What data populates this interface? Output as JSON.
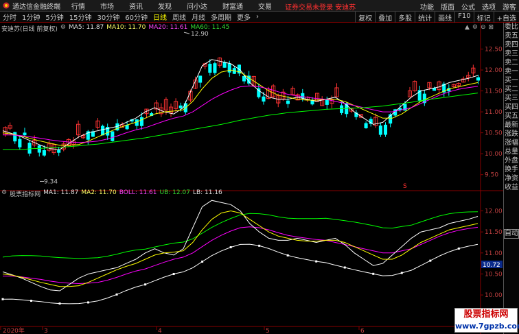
{
  "app": {
    "title": "通达信金融终端",
    "menu": [
      "行情",
      "市场",
      "资讯",
      "发现",
      "问小达",
      "财富通",
      "交易"
    ],
    "alert": "证券交易未登录 安迪苏",
    "right_menu": [
      "功能",
      "版面",
      "公式",
      "选项",
      "游客"
    ]
  },
  "toolbar": {
    "periods": [
      "分时",
      "1分钟",
      "5分钟",
      "15分钟",
      "30分钟",
      "60分钟",
      "日线",
      "周线",
      "月线",
      "多周期",
      "更多"
    ],
    "active_period": "日线",
    "tools": [
      "复权",
      "叠加",
      "多股",
      "统计",
      "画线",
      "F10",
      "标记",
      "+自选"
    ]
  },
  "main_chart": {
    "stock_name": "安迪苏(日线 前复权)",
    "ma5": "MA5: 11.87",
    "ma10": "MA10: 11.70",
    "ma20": "MA20: 11.61",
    "ma60": "MA60: 11.45",
    "high_label": "12.90",
    "low_label": "9.34",
    "s_marker": "S",
    "price_axis": [
      "12.50",
      "12.00",
      "11.50",
      "11.00",
      "10.50",
      "10.00",
      "9.50"
    ]
  },
  "sub_chart": {
    "name": "股票指标网",
    "ma1": "MA1: 11.87",
    "ma2": "MA2: 11.70",
    "boll": "BOLL: 11.61",
    "ub": "UB: 12.07",
    "lb": "LB: 11.16",
    "price_axis": [
      "12.00",
      "11.50",
      "11.00",
      "10.50",
      "10.00"
    ],
    "current_price": "10.72"
  },
  "x_axis": [
    "2020年",
    "3",
    "4",
    "5",
    "6"
  ],
  "sidebar": {
    "tabs": [
      "委比",
      "卖五",
      "卖四",
      "卖三",
      "卖二",
      "卖一",
      "买一",
      "买二",
      "买三",
      "买四",
      "买五",
      "最新",
      "涨跌",
      "涨幅",
      "总量",
      "外盘",
      "换手",
      "净资",
      "收益"
    ],
    "auto": "自动"
  },
  "watermark": {
    "line1": "股票指标网",
    "line2": "www.7gpzb.com"
  },
  "colors": {
    "up": "#ff3333",
    "down": "#00ffff",
    "ma5": "#ffffff",
    "ma10": "#ffff00",
    "ma20": "#ff00ff",
    "ma60": "#00ff00"
  },
  "chart_data": {
    "type": "line",
    "series": [
      {
        "name": "MA5",
        "values": [
          10.55,
          10.48,
          10.4,
          10.3,
          10.2,
          10.12,
          10.1,
          10.25,
          10.4,
          10.5,
          10.55,
          10.6,
          10.65,
          10.75,
          10.85,
          11.0,
          11.1,
          11.0,
          10.95,
          11.1,
          11.6,
          12.1,
          12.25,
          12.2,
          12.15,
          12.0,
          11.7,
          11.5,
          11.35,
          11.3,
          11.3,
          11.35,
          11.3,
          11.25,
          11.3,
          11.35,
          11.2,
          11.0,
          10.85,
          10.7,
          10.75,
          10.95,
          11.15,
          11.35,
          11.5,
          11.55,
          11.6,
          11.7,
          11.75,
          11.8,
          11.87
        ]
      },
      {
        "name": "MA10",
        "values": [
          10.5,
          10.47,
          10.42,
          10.36,
          10.3,
          10.25,
          10.2,
          10.2,
          10.22,
          10.3,
          10.4,
          10.5,
          10.6,
          10.68,
          10.75,
          10.85,
          10.95,
          11.0,
          11.02,
          11.05,
          11.25,
          11.55,
          11.8,
          11.95,
          12.0,
          11.95,
          11.8,
          11.65,
          11.5,
          11.4,
          11.35,
          11.3,
          11.28,
          11.28,
          11.3,
          11.3,
          11.25,
          11.15,
          11.05,
          10.95,
          10.85,
          10.85,
          10.95,
          11.1,
          11.25,
          11.35,
          11.45,
          11.55,
          11.6,
          11.65,
          11.7
        ]
      },
      {
        "name": "MA20",
        "values": [
          10.45,
          10.45,
          10.43,
          10.4,
          10.37,
          10.33,
          10.3,
          10.28,
          10.27,
          10.28,
          10.3,
          10.35,
          10.42,
          10.5,
          10.57,
          10.62,
          10.7,
          10.78,
          10.85,
          10.9,
          11.0,
          11.15,
          11.3,
          11.42,
          11.52,
          11.6,
          11.62,
          11.6,
          11.55,
          11.48,
          11.42,
          11.38,
          11.35,
          11.32,
          11.3,
          11.25,
          11.2,
          11.15,
          11.1,
          11.05,
          11.0,
          11.0,
          11.05,
          11.1,
          11.2,
          11.3,
          11.4,
          11.48,
          11.54,
          11.58,
          11.61
        ]
      },
      {
        "name": "MA60",
        "values": [
          10.1,
          10.1,
          10.1,
          10.12,
          10.13,
          10.14,
          10.15,
          10.17,
          10.19,
          10.21,
          10.23,
          10.26,
          10.29,
          10.32,
          10.35,
          10.38,
          10.42,
          10.46,
          10.5,
          10.54,
          10.58,
          10.62,
          10.66,
          10.7,
          10.75,
          10.8,
          10.84,
          10.88,
          10.92,
          10.95,
          10.98,
          11.0,
          11.02,
          11.04,
          11.06,
          11.07,
          11.08,
          11.09,
          11.1,
          11.12,
          11.14,
          11.17,
          11.2,
          11.23,
          11.27,
          11.3,
          11.33,
          11.36,
          11.39,
          11.42,
          11.45
        ]
      }
    ],
    "ylim": [
      9.2,
      13.0
    ]
  }
}
